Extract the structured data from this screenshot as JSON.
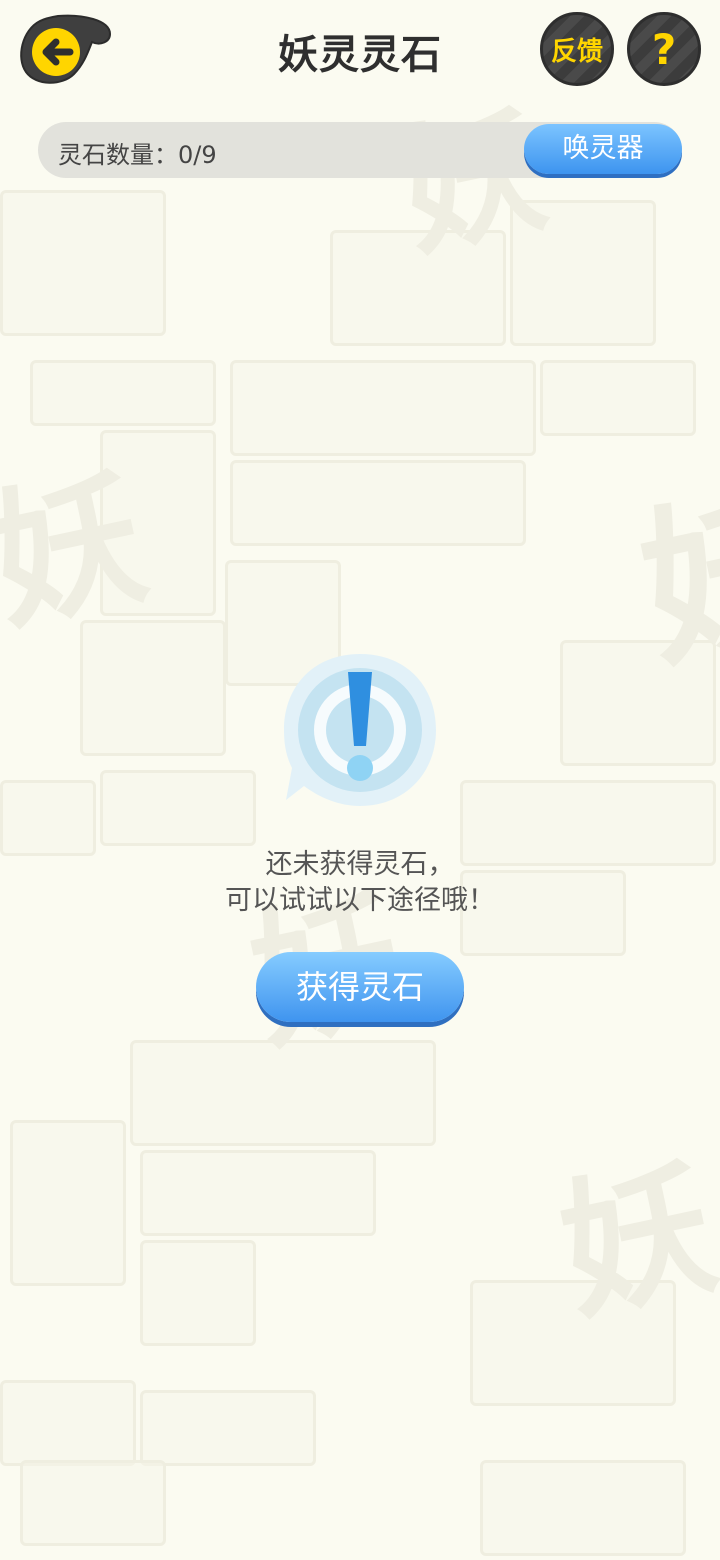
{
  "header": {
    "title": "妖灵灵石",
    "feedback_label": "反馈",
    "help_label": "?"
  },
  "stones": {
    "count_label": "灵石数量：0/9",
    "summon_label": "唤灵器"
  },
  "empty_state": {
    "line1": "还未获得灵石，",
    "line2": "可以试试以下途径哦！",
    "button_label": "获得灵石"
  },
  "colors": {
    "background": "#fbfbf1",
    "accent_yellow": "#ffd500",
    "button_blue": "#3f94ef"
  }
}
